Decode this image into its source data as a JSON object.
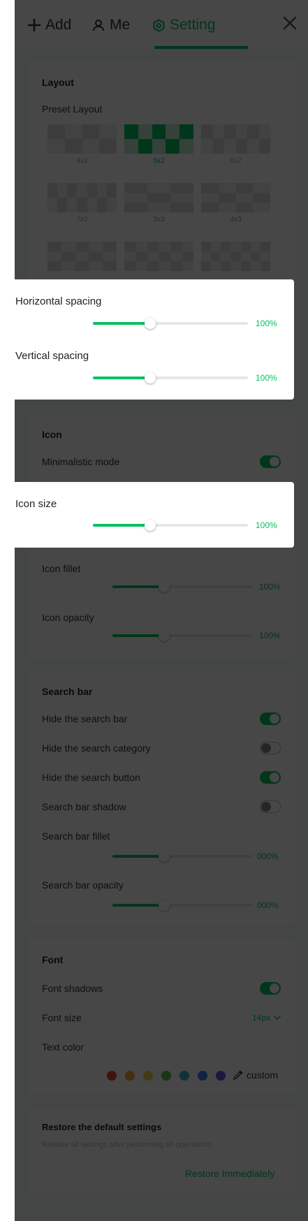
{
  "header": {
    "tabs": [
      {
        "label": "Add",
        "icon": "plus-icon"
      },
      {
        "label": "Me",
        "icon": "user-icon"
      },
      {
        "label": "Setting",
        "icon": "gear-icon",
        "active": true
      }
    ],
    "close_icon": "close-icon"
  },
  "colors": {
    "accent": "#07c160",
    "overlay": "rgba(0,0,0,0.72)"
  },
  "layout": {
    "title": "Layout",
    "preset_label": "Preset Layout",
    "presets": [
      {
        "label": "4x2",
        "selected": false
      },
      {
        "label": "5x2",
        "selected": true
      },
      {
        "label": "6x2",
        "selected": false
      },
      {
        "label": "7x2",
        "selected": false
      },
      {
        "label": "3x3",
        "selected": false
      },
      {
        "label": "4x3",
        "selected": false
      },
      {
        "label": "",
        "selected": false
      },
      {
        "label": "",
        "selected": false
      },
      {
        "label": "",
        "selected": false
      }
    ]
  },
  "spacing": {
    "horizontal_label": "Horizontal spacing",
    "horizontal_value": "100%",
    "horizontal_level": 0.37,
    "vertical_label": "Vertical spacing",
    "vertical_value": "100%",
    "vertical_level": 0.37
  },
  "icon": {
    "title": "Icon",
    "minimalistic_label": "Minimalistic mode",
    "minimalistic_on": true,
    "size_label": "Icon size",
    "size_value": "100%",
    "size_level": 0.37,
    "fillet_label": "Icon fillet",
    "fillet_value": "100%",
    "fillet_level": 0.37,
    "opacity_label": "Icon opacity",
    "opacity_value": "100%",
    "opacity_level": 0.37
  },
  "search_bar": {
    "title": "Search bar",
    "hide_bar_label": "Hide the search bar",
    "hide_bar_on": true,
    "hide_category_label": "Hide the search category",
    "hide_category_on": false,
    "hide_button_label": "Hide the search button",
    "hide_button_on": true,
    "shadow_label": "Search bar shadow",
    "shadow_on": false,
    "fillet_label": "Search bar fillet",
    "fillet_value": "000%",
    "fillet_level": 0.37,
    "opacity_label": "Search bar opacity",
    "opacity_value": "000%",
    "opacity_level": 0.37
  },
  "font": {
    "title": "Font",
    "shadows_label": "Font shadows",
    "shadows_on": true,
    "size_label": "Font size",
    "size_value": "14px",
    "text_color_label": "Text color",
    "swatches": [
      "#e8472f",
      "#f3a13a",
      "#f0d54a",
      "#5bc155",
      "#3bb7c4",
      "#3b7ef3",
      "#6f4ce6"
    ],
    "custom_label": "custom"
  },
  "restore": {
    "title": "Restore the default settings",
    "description": "Restore all settings after performing all operations",
    "action_label": "Restore Immediately"
  }
}
